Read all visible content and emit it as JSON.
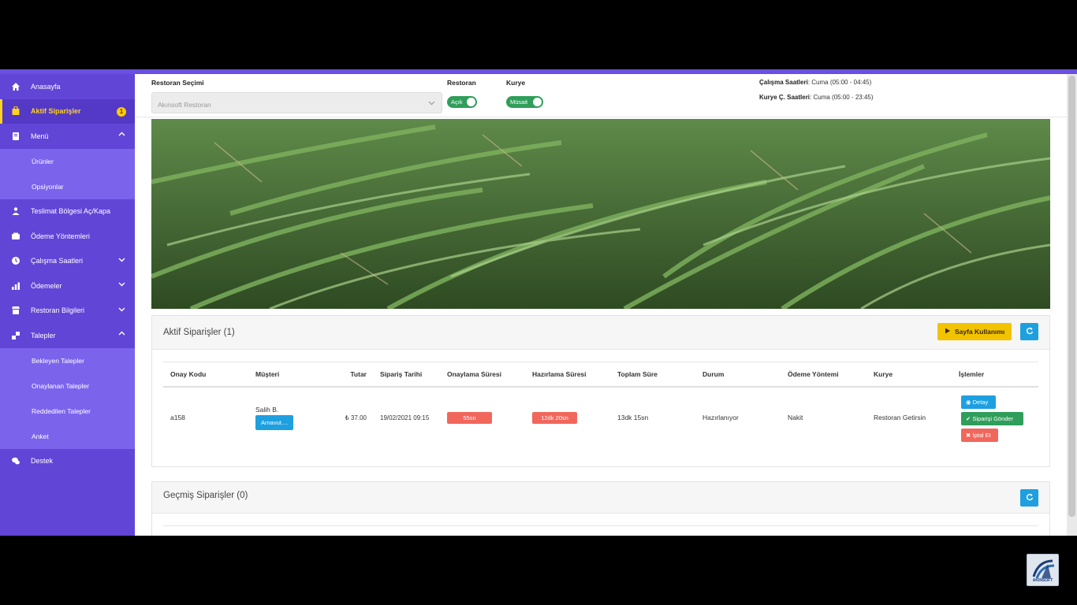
{
  "sidebar": {
    "items": [
      {
        "label": "Anasayfa",
        "icon": "home-icon"
      },
      {
        "label": "Aktif Siparişler",
        "icon": "shopping-bag-icon",
        "badge": "1"
      },
      {
        "label": "Menü",
        "icon": "book-icon"
      },
      {
        "label": "Teslimat Bölgesi Aç/Kapa",
        "icon": "delivery-icon"
      },
      {
        "label": "Ödeme Yöntemleri",
        "icon": "wallet-icon"
      },
      {
        "label": "Çalışma Saatleri",
        "icon": "clock-icon"
      },
      {
        "label": "Ödemeler",
        "icon": "chart-icon"
      },
      {
        "label": "Restoran Bilgileri",
        "icon": "store-icon"
      },
      {
        "label": "Talepler",
        "icon": "request-icon"
      },
      {
        "label": "Destek",
        "icon": "chat-icon"
      }
    ],
    "menu_sub": [
      "Ürünler",
      "Opsiyonlar"
    ],
    "talepler_sub": [
      "Bekleyen Talepler",
      "Onaylanan Talepler",
      "Reddedilen Talepler",
      "Anket"
    ]
  },
  "header": {
    "restoran_secimi_label": "Restoran Seçimi",
    "restoran_select_value": "Akınsoft Restoran",
    "restoran_label": "Restoran",
    "restoran_toggle": "Açık",
    "kurye_label": "Kurye",
    "kurye_toggle": "Müsait",
    "calisma_label": "Çalışma Saatleri",
    "calisma_value": ": Cuma (05:00 - 04:45)",
    "kurye_c_label": "Kurye Ç. Saatleri",
    "kurye_c_value": ": Cuma (05:00 - 23:45)"
  },
  "active_orders": {
    "title": "Aktif Siparişler (1)",
    "sayfa_btn": "Sayfa Kullanımı",
    "columns": [
      "Onay Kodu",
      "Müşteri",
      "Tutar",
      "Sipariş Tarihi",
      "Onaylama Süresi",
      "Hazırlama Süresi",
      "Toplam Süre",
      "Durum",
      "Ödeme Yöntemi",
      "Kurye",
      "İşlemler"
    ],
    "rows": [
      {
        "code": "a158",
        "customer": "Salih B.",
        "customer_btn": "Arnavut....",
        "amount": "₺ 37.00",
        "date": "19/02/2021 09:15",
        "approve_time": "55sn",
        "prep_time": "12dk 20sn",
        "total_time": "13dk 15sn",
        "status": "Hazırlanıyor",
        "payment": "Nakit",
        "courier": "Restoran Getirsin",
        "btn_detail": "Detay",
        "btn_send": "Siparişi Gönder",
        "btn_cancel": "İptal Et"
      }
    ]
  },
  "past_orders": {
    "title": "Geçmiş Siparişler (0)"
  },
  "watermark": {
    "text": "AKINSOFT"
  }
}
